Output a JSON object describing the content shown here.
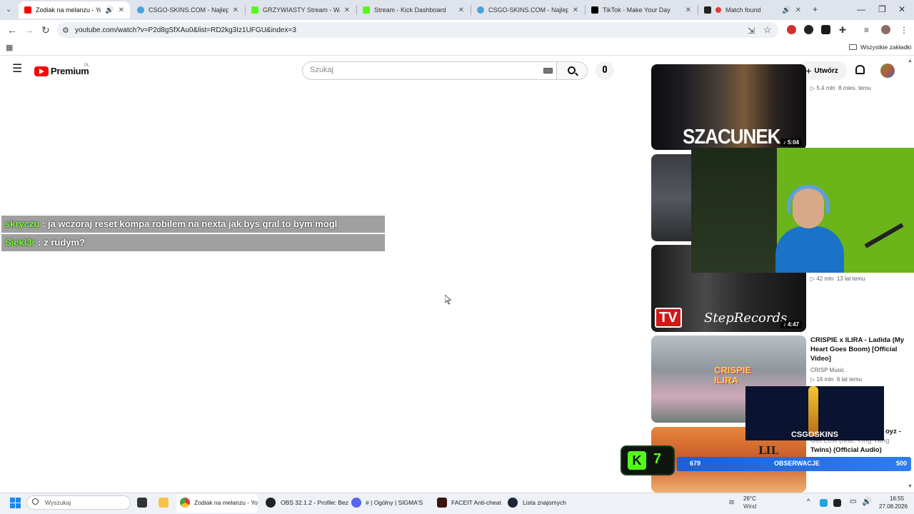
{
  "browser": {
    "tabs": [
      {
        "title": "Zodiak na melanzu - YouTu",
        "active": true,
        "color": "#ff0000"
      },
      {
        "title": "CSGO-SKINS.COM - Najlepsze",
        "active": false,
        "color": "#4aa3df"
      },
      {
        "title": "GRZYWIASTY Stream - Watch L",
        "active": false,
        "color": "#53fc18"
      },
      {
        "title": "Stream - Kick Dashboard",
        "active": false,
        "color": "#53fc18"
      },
      {
        "title": "CSGO-SKINS.COM - Najlepsze",
        "active": false,
        "color": "#4aa3df"
      },
      {
        "title": "TikTok - Make Your Day",
        "active": false,
        "color": "#000000"
      },
      {
        "title": "Match found",
        "active": false,
        "color": "#e23a3a"
      }
    ],
    "url": "youtube.com/watch?v=P2d8gSfXAu0&list=RD2kg3Iz1UFGU&index=3",
    "bookmarks_label": "Wszystkie zakładki"
  },
  "youtube": {
    "logo_text": "Premium",
    "logo_region": "PL",
    "search_placeholder": "Szukaj",
    "create_label": "Utwórz"
  },
  "chat": [
    {
      "user": "skryczu",
      "message": ": ja wczoraj reset kompa robilem na nexta jak bys gral to bym mogl"
    },
    {
      "user": "Siekl3r",
      "message": ": z rudym?"
    }
  ],
  "sidebar": {
    "videos": [
      {
        "thumb_text": "SZACUNEK",
        "duration": "5:04",
        "views": "5,4 mln",
        "age": "8 mies. temu"
      },
      {
        "thumb_text": "",
        "duration": "",
        "views": "",
        "age": ""
      },
      {
        "thumb_text": "StepRecords",
        "badge": "TV",
        "duration": "4:47",
        "views": "42 mln",
        "age": "13 lat temu"
      },
      {
        "title": "CRISPIE x ILIRA - Ladida (My Heart Goes Boom) [Official Video]",
        "channel": "CRISP Music",
        "views": "16 mln",
        "age": "6 lat temu",
        "thumb_text": "CRISPIE ILIRA"
      },
      {
        "title_partial": "oyz -",
        "title_line2": "Get Low (feat. Ying Yang",
        "title_line3": "Twins) (Official Audio)",
        "thumb_text": "LIL JON"
      }
    ]
  },
  "overlays": {
    "cs_label": "CSGOSKINS",
    "kick_number": "7",
    "obs_left": "679",
    "obs_center": "OBSERWACJE",
    "obs_right": "500"
  },
  "taskbar": {
    "search_placeholder": "Wyszukaj",
    "apps": [
      {
        "label": "Zodiak na melanzu - Yo"
      },
      {
        "label": "OBS 32.1.2 - Profile: Bez"
      },
      {
        "label": "# | Ogólny | SIGMA'S"
      },
      {
        "label": "FACEIT Anti-cheat"
      },
      {
        "label": "Lista znajomych"
      }
    ],
    "weather_temp": "26°C",
    "weather_desc": "Wind",
    "time": "16:55",
    "date": "27.08.2026"
  }
}
